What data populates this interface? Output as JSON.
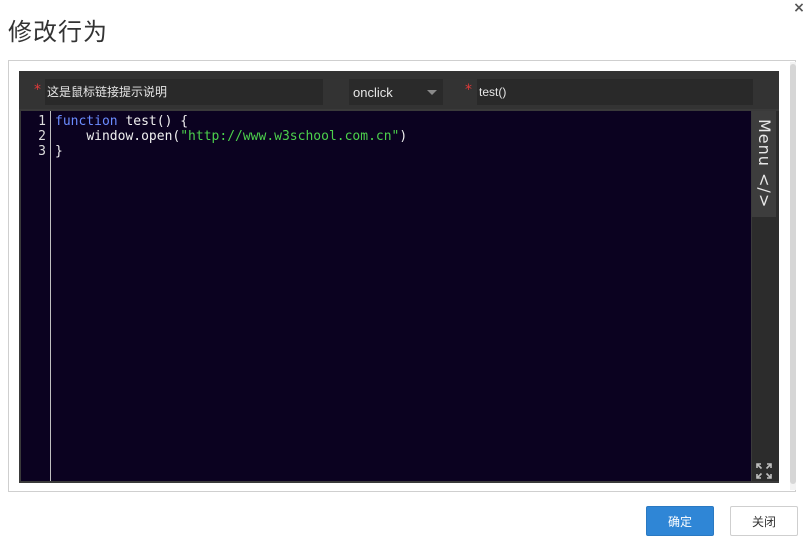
{
  "dialog": {
    "title": "修改行为",
    "close_glyph": "×"
  },
  "toolbar": {
    "required_marker": "*",
    "description_value": "这是鼠标链接提示说明",
    "event_value": "onclick",
    "function_value": "test()"
  },
  "editor": {
    "line_numbers": [
      "1",
      "2",
      "3"
    ],
    "lines": [
      {
        "keyword": "function",
        "rest": " test() {"
      },
      {
        "indent": "    ",
        "prefix": "window.open(",
        "string": "\"http://www.w3school.com.cn\"",
        "suffix": ")"
      },
      {
        "text": "}"
      }
    ],
    "menu_label": "Menu </>"
  },
  "footer": {
    "confirm_label": "确定",
    "close_label": "关闭"
  },
  "colors": {
    "editor_bg": "#0b0220",
    "keyword": "#6b8cff",
    "string": "#4cd14c",
    "primary_button": "#2f86d6",
    "required": "#e23a3a"
  },
  "icons": {
    "close": "close-icon",
    "dropdown": "chevron-down-icon",
    "fullscreen": "expand-icon"
  }
}
